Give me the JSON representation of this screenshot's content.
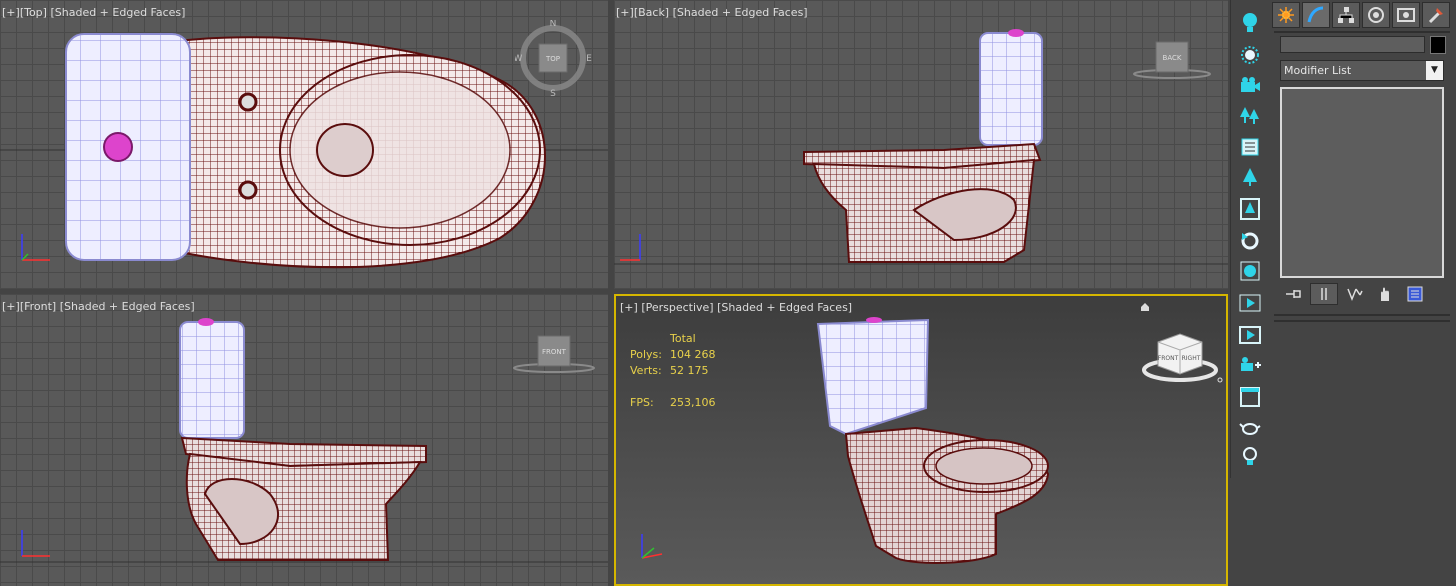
{
  "viewports": {
    "top": {
      "plus": "[+]",
      "view": "[Top]",
      "shading": "[Shaded + Edged Faces]",
      "cube_label": "TOP",
      "compass": {
        "n": "N",
        "s": "S",
        "e": "E",
        "w": "W"
      }
    },
    "back": {
      "plus": "[+]",
      "view": "[Back]",
      "shading": "[Shaded + Edged Faces]",
      "cube_label": "BACK"
    },
    "front": {
      "plus": "[+]",
      "view": "[Front]",
      "shading": "[Shaded + Edged Faces]",
      "cube_label": "FRONT"
    },
    "perspective": {
      "plus": "[+]",
      "view": "[Perspective]",
      "shading": "[Shaded + Edged Faces]",
      "cube_left": "FRONT",
      "cube_right": "RIGHT"
    }
  },
  "stats": {
    "header": "Total",
    "polys_label": "Polys:",
    "polys_value": "104 268",
    "verts_label": "Verts:",
    "verts_value": "52 175",
    "fps_label": "FPS:",
    "fps_value": "253,106"
  },
  "axis_labels": {
    "z": "z",
    "y": "y",
    "x": "x"
  },
  "toolbar_icons": [
    "bulb-icon",
    "sun-icon",
    "camera-icon",
    "trees-icon",
    "page-icon",
    "tree-icon",
    "tree-frame-icon",
    "refresh-icon",
    "sphere-icon",
    "play-icon",
    "play-frame-icon",
    "camera-add-icon",
    "window-icon",
    "teapot-icon",
    "lightbulb-icon"
  ],
  "command_panel": {
    "tabs": [
      "create-tab",
      "modify-tab",
      "hierarchy-tab",
      "motion-tab",
      "display-tab",
      "utilities-tab"
    ],
    "name_value": "",
    "modifier_list": "Modifier List",
    "colors": {
      "swatch": "#000000",
      "model_wire": "#5a0d0d",
      "tank_fill": "#ecebff",
      "button_accent": "#dd44cc",
      "stats_text": "#e8d14b",
      "active_border": "#d5b600"
    }
  }
}
